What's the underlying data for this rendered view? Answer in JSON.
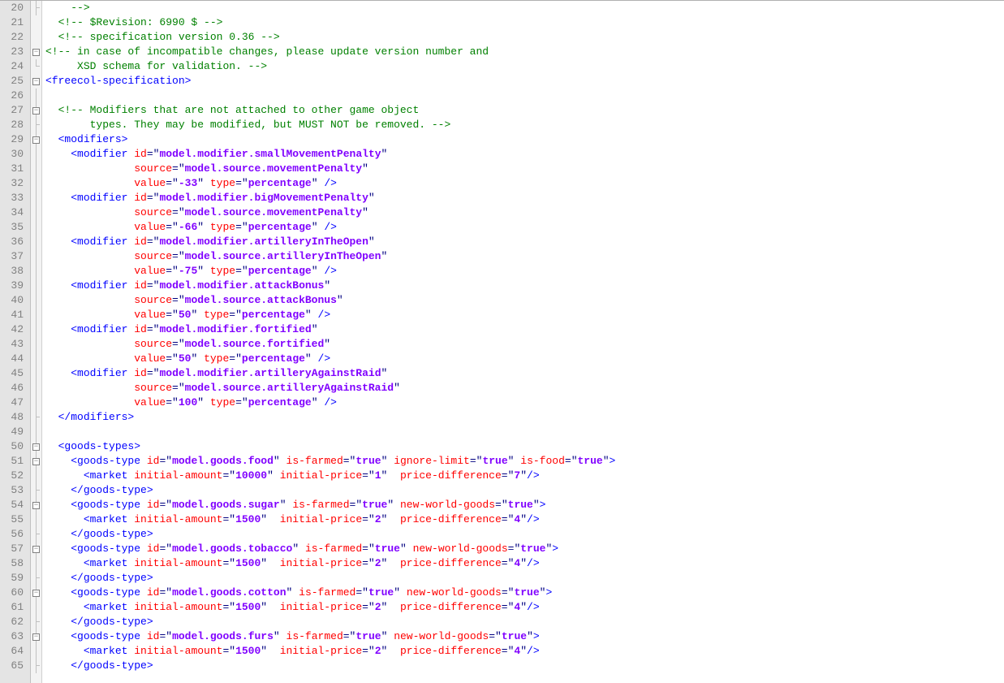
{
  "lines": [
    {
      "n": 20,
      "fold": "cornerLine",
      "html": "    <span class='comment'>--&gt;</span>"
    },
    {
      "n": 21,
      "fold": "",
      "html": "  <span class='comment'>&lt;!-- $Revision: 6990 $ --&gt;</span>"
    },
    {
      "n": 22,
      "fold": "",
      "html": "  <span class='comment'>&lt;!-- specification version 0.36 --&gt;</span>"
    },
    {
      "n": 23,
      "fold": "box",
      "html": "<span class='comment'>&lt;!-- in case of incompatible changes, please update version number and</span>"
    },
    {
      "n": 24,
      "fold": "corner",
      "html": "     <span class='comment'>XSD schema for validation. --&gt;</span>"
    },
    {
      "n": 25,
      "fold": "box",
      "html": "<span class='tag'>&lt;freecol-specification&gt;</span>"
    },
    {
      "n": 26,
      "fold": "line",
      "html": ""
    },
    {
      "n": 27,
      "fold": "boxLine",
      "html": "  <span class='comment'>&lt;!-- Modifiers that are not attached to other game object</span>"
    },
    {
      "n": 28,
      "fold": "cornerLine",
      "html": "       <span class='comment'>types. They may be modified, but MUST NOT be removed. --&gt;</span>"
    },
    {
      "n": 29,
      "fold": "boxLine",
      "html": "  <span class='tag'>&lt;modifiers&gt;</span>"
    },
    {
      "n": 30,
      "fold": "line",
      "html": "    <span class='tag'>&lt;modifier</span> <span class='attr'>id</span><span class='punct'>=</span><span class='punct'>\"</span><span class='val'>model.modifier.smallMovementPenalty</span><span class='punct'>\"</span>"
    },
    {
      "n": 31,
      "fold": "line",
      "html": "              <span class='attr'>source</span><span class='punct'>=\"</span><span class='val'>model.source.movementPenalty</span><span class='punct'>\"</span>"
    },
    {
      "n": 32,
      "fold": "line",
      "html": "              <span class='attr'>value</span><span class='punct'>=\"</span><span class='val'>-33</span><span class='punct'>\"</span> <span class='attr'>type</span><span class='punct'>=\"</span><span class='val'>percentage</span><span class='punct'>\"</span> <span class='tag'>/&gt;</span>"
    },
    {
      "n": 33,
      "fold": "line",
      "html": "    <span class='tag'>&lt;modifier</span> <span class='attr'>id</span><span class='punct'>=\"</span><span class='val'>model.modifier.bigMovementPenalty</span><span class='punct'>\"</span>"
    },
    {
      "n": 34,
      "fold": "line",
      "html": "              <span class='attr'>source</span><span class='punct'>=\"</span><span class='val'>model.source.movementPenalty</span><span class='punct'>\"</span>"
    },
    {
      "n": 35,
      "fold": "line",
      "html": "              <span class='attr'>value</span><span class='punct'>=\"</span><span class='val'>-66</span><span class='punct'>\"</span> <span class='attr'>type</span><span class='punct'>=\"</span><span class='val'>percentage</span><span class='punct'>\"</span> <span class='tag'>/&gt;</span>"
    },
    {
      "n": 36,
      "fold": "line",
      "html": "    <span class='tag'>&lt;modifier</span> <span class='attr'>id</span><span class='punct'>=\"</span><span class='val'>model.modifier.artilleryInTheOpen</span><span class='punct'>\"</span>"
    },
    {
      "n": 37,
      "fold": "line",
      "html": "              <span class='attr'>source</span><span class='punct'>=\"</span><span class='val'>model.source.artilleryInTheOpen</span><span class='punct'>\"</span>"
    },
    {
      "n": 38,
      "fold": "line",
      "html": "              <span class='attr'>value</span><span class='punct'>=\"</span><span class='val'>-75</span><span class='punct'>\"</span> <span class='attr'>type</span><span class='punct'>=\"</span><span class='val'>percentage</span><span class='punct'>\"</span> <span class='tag'>/&gt;</span>"
    },
    {
      "n": 39,
      "fold": "line",
      "html": "    <span class='tag'>&lt;modifier</span> <span class='attr'>id</span><span class='punct'>=\"</span><span class='val'>model.modifier.attackBonus</span><span class='punct'>\"</span>"
    },
    {
      "n": 40,
      "fold": "line",
      "html": "              <span class='attr'>source</span><span class='punct'>=\"</span><span class='val'>model.source.attackBonus</span><span class='punct'>\"</span>"
    },
    {
      "n": 41,
      "fold": "line",
      "html": "              <span class='attr'>value</span><span class='punct'>=\"</span><span class='val'>50</span><span class='punct'>\"</span> <span class='attr'>type</span><span class='punct'>=\"</span><span class='val'>percentage</span><span class='punct'>\"</span> <span class='tag'>/&gt;</span>"
    },
    {
      "n": 42,
      "fold": "line",
      "html": "    <span class='tag'>&lt;modifier</span> <span class='attr'>id</span><span class='punct'>=\"</span><span class='val'>model.modifier.fortified</span><span class='punct'>\"</span>"
    },
    {
      "n": 43,
      "fold": "line",
      "html": "              <span class='attr'>source</span><span class='punct'>=\"</span><span class='val'>model.source.fortified</span><span class='punct'>\"</span>"
    },
    {
      "n": 44,
      "fold": "line",
      "html": "              <span class='attr'>value</span><span class='punct'>=\"</span><span class='val'>50</span><span class='punct'>\"</span> <span class='attr'>type</span><span class='punct'>=\"</span><span class='val'>percentage</span><span class='punct'>\"</span> <span class='tag'>/&gt;</span>"
    },
    {
      "n": 45,
      "fold": "line",
      "html": "    <span class='tag'>&lt;modifier</span> <span class='attr'>id</span><span class='punct'>=\"</span><span class='val'>model.modifier.artilleryAgainstRaid</span><span class='punct'>\"</span>"
    },
    {
      "n": 46,
      "fold": "line",
      "html": "              <span class='attr'>source</span><span class='punct'>=\"</span><span class='val'>model.source.artilleryAgainstRaid</span><span class='punct'>\"</span>"
    },
    {
      "n": 47,
      "fold": "line",
      "html": "              <span class='attr'>value</span><span class='punct'>=\"</span><span class='val'>100</span><span class='punct'>\"</span> <span class='attr'>type</span><span class='punct'>=\"</span><span class='val'>percentage</span><span class='punct'>\"</span> <span class='tag'>/&gt;</span>"
    },
    {
      "n": 48,
      "fold": "cornerLine",
      "html": "  <span class='tag'>&lt;/modifiers&gt;</span>"
    },
    {
      "n": 49,
      "fold": "line",
      "html": ""
    },
    {
      "n": 50,
      "fold": "boxLine",
      "html": "  <span class='tag'>&lt;goods-types&gt;</span>"
    },
    {
      "n": 51,
      "fold": "boxLine",
      "html": "    <span class='tag'>&lt;goods-type</span> <span class='attr'>id</span><span class='punct'>=\"</span><span class='val'>model.goods.food</span><span class='punct'>\"</span> <span class='attr'>is-farmed</span><span class='punct'>=\"</span><span class='val'>true</span><span class='punct'>\"</span> <span class='attr'>ignore-limit</span><span class='punct'>=\"</span><span class='val'>true</span><span class='punct'>\"</span> <span class='attr'>is-food</span><span class='punct'>=\"</span><span class='val'>true</span><span class='punct'>\"</span><span class='tag'>&gt;</span>"
    },
    {
      "n": 52,
      "fold": "line",
      "html": "      <span class='tag'>&lt;market</span> <span class='attr'>initial-amount</span><span class='punct'>=\"</span><span class='val'>10000</span><span class='punct'>\"</span> <span class='attr'>initial-price</span><span class='punct'>=\"</span><span class='val'>1</span><span class='punct'>\"</span>  <span class='attr'>price-difference</span><span class='punct'>=\"</span><span class='val'>7</span><span class='punct'>\"</span><span class='tag'>/&gt;</span>"
    },
    {
      "n": 53,
      "fold": "cornerLine",
      "html": "    <span class='tag'>&lt;/goods-type&gt;</span>"
    },
    {
      "n": 54,
      "fold": "boxLine",
      "html": "    <span class='tag'>&lt;goods-type</span> <span class='attr'>id</span><span class='punct'>=\"</span><span class='val'>model.goods.sugar</span><span class='punct'>\"</span> <span class='attr'>is-farmed</span><span class='punct'>=\"</span><span class='val'>true</span><span class='punct'>\"</span> <span class='attr'>new-world-goods</span><span class='punct'>=\"</span><span class='val'>true</span><span class='punct'>\"</span><span class='tag'>&gt;</span>"
    },
    {
      "n": 55,
      "fold": "line",
      "html": "      <span class='tag'>&lt;market</span> <span class='attr'>initial-amount</span><span class='punct'>=\"</span><span class='val'>1500</span><span class='punct'>\"</span>  <span class='attr'>initial-price</span><span class='punct'>=\"</span><span class='val'>2</span><span class='punct'>\"</span>  <span class='attr'>price-difference</span><span class='punct'>=\"</span><span class='val'>4</span><span class='punct'>\"</span><span class='tag'>/&gt;</span>"
    },
    {
      "n": 56,
      "fold": "cornerLine",
      "html": "    <span class='tag'>&lt;/goods-type&gt;</span>"
    },
    {
      "n": 57,
      "fold": "boxLine",
      "html": "    <span class='tag'>&lt;goods-type</span> <span class='attr'>id</span><span class='punct'>=\"</span><span class='val'>model.goods.tobacco</span><span class='punct'>\"</span> <span class='attr'>is-farmed</span><span class='punct'>=\"</span><span class='val'>true</span><span class='punct'>\"</span> <span class='attr'>new-world-goods</span><span class='punct'>=\"</span><span class='val'>true</span><span class='punct'>\"</span><span class='tag'>&gt;</span>"
    },
    {
      "n": 58,
      "fold": "line",
      "html": "      <span class='tag'>&lt;market</span> <span class='attr'>initial-amount</span><span class='punct'>=\"</span><span class='val'>1500</span><span class='punct'>\"</span>  <span class='attr'>initial-price</span><span class='punct'>=\"</span><span class='val'>2</span><span class='punct'>\"</span>  <span class='attr'>price-difference</span><span class='punct'>=\"</span><span class='val'>4</span><span class='punct'>\"</span><span class='tag'>/&gt;</span>"
    },
    {
      "n": 59,
      "fold": "cornerLine",
      "html": "    <span class='tag'>&lt;/goods-type&gt;</span>"
    },
    {
      "n": 60,
      "fold": "boxLine",
      "html": "    <span class='tag'>&lt;goods-type</span> <span class='attr'>id</span><span class='punct'>=\"</span><span class='val'>model.goods.cotton</span><span class='punct'>\"</span> <span class='attr'>is-farmed</span><span class='punct'>=\"</span><span class='val'>true</span><span class='punct'>\"</span> <span class='attr'>new-world-goods</span><span class='punct'>=\"</span><span class='val'>true</span><span class='punct'>\"</span><span class='tag'>&gt;</span>"
    },
    {
      "n": 61,
      "fold": "line",
      "html": "      <span class='tag'>&lt;market</span> <span class='attr'>initial-amount</span><span class='punct'>=\"</span><span class='val'>1500</span><span class='punct'>\"</span>  <span class='attr'>initial-price</span><span class='punct'>=\"</span><span class='val'>2</span><span class='punct'>\"</span>  <span class='attr'>price-difference</span><span class='punct'>=\"</span><span class='val'>4</span><span class='punct'>\"</span><span class='tag'>/&gt;</span>"
    },
    {
      "n": 62,
      "fold": "cornerLine",
      "html": "    <span class='tag'>&lt;/goods-type&gt;</span>"
    },
    {
      "n": 63,
      "fold": "boxLine",
      "html": "    <span class='tag'>&lt;goods-type</span> <span class='attr'>id</span><span class='punct'>=\"</span><span class='val'>model.goods.furs</span><span class='punct'>\"</span> <span class='attr'>is-farmed</span><span class='punct'>=\"</span><span class='val'>true</span><span class='punct'>\"</span> <span class='attr'>new-world-goods</span><span class='punct'>=\"</span><span class='val'>true</span><span class='punct'>\"</span><span class='tag'>&gt;</span>"
    },
    {
      "n": 64,
      "fold": "line",
      "html": "      <span class='tag'>&lt;market</span> <span class='attr'>initial-amount</span><span class='punct'>=\"</span><span class='val'>1500</span><span class='punct'>\"</span>  <span class='attr'>initial-price</span><span class='punct'>=\"</span><span class='val'>2</span><span class='punct'>\"</span>  <span class='attr'>price-difference</span><span class='punct'>=\"</span><span class='val'>4</span><span class='punct'>\"</span><span class='tag'>/&gt;</span>"
    },
    {
      "n": 65,
      "fold": "cornerLine",
      "html": "    <span class='tag'>&lt;/goods-type&gt;</span>"
    }
  ]
}
